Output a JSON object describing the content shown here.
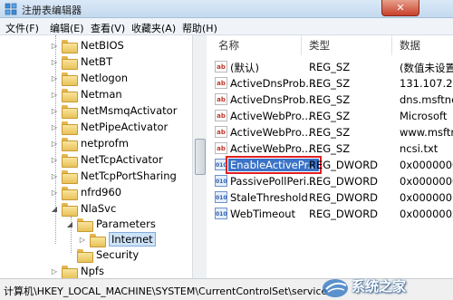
{
  "window": {
    "title": "注册表编辑器",
    "close_label": "✕"
  },
  "menu": [
    "文件(F)",
    "编辑(E)",
    "查看(V)",
    "收藏夹(A)",
    "帮助(H)"
  ],
  "tree": {
    "items": [
      {
        "label": "NetBIOS",
        "expander": "▷"
      },
      {
        "label": "NetBT",
        "expander": "▷"
      },
      {
        "label": "Netlogon",
        "expander": "▷"
      },
      {
        "label": "Netman",
        "expander": "▷"
      },
      {
        "label": "NetMsmqActivator",
        "expander": "▷"
      },
      {
        "label": "NetPipeActivator",
        "expander": "▷"
      },
      {
        "label": "netprofm",
        "expander": "▷"
      },
      {
        "label": "NetTcpActivator",
        "expander": "▷"
      },
      {
        "label": "NetTcpPortSharing",
        "expander": "▷"
      },
      {
        "label": "nfrd960",
        "expander": "▷"
      },
      {
        "label": "NlaSvc",
        "expander": "◢"
      },
      {
        "label": "Parameters",
        "expander": "◢"
      },
      {
        "label": "Internet",
        "expander": "▷"
      },
      {
        "label": "Security",
        "expander": ""
      },
      {
        "label": "Npfs",
        "expander": "▷"
      }
    ]
  },
  "columns": {
    "name": "名称",
    "type": "类型",
    "data": "数据"
  },
  "values": [
    {
      "name": "(默认)",
      "type": "REG_SZ",
      "data": "(数值未设置",
      "icon": "ab"
    },
    {
      "name": "ActiveDnsProb...",
      "type": "REG_SZ",
      "data": "131.107.25",
      "icon": "ab"
    },
    {
      "name": "ActiveDnsProb...",
      "type": "REG_SZ",
      "data": "dns.msftnc",
      "icon": "ab"
    },
    {
      "name": "ActiveWebPro...",
      "type": "REG_SZ",
      "data": "Microsoft",
      "icon": "ab"
    },
    {
      "name": "ActiveWebPro...",
      "type": "REG_SZ",
      "data": "www.msftn",
      "icon": "ab"
    },
    {
      "name": "ActiveWebPro...",
      "type": "REG_SZ",
      "data": "ncsi.txt",
      "icon": "ab"
    },
    {
      "name": "EnableActivePr...",
      "type": "REG_DWORD",
      "data": "0x0000000",
      "icon": "010",
      "selected": true
    },
    {
      "name": "PassivePollPeri...",
      "type": "REG_DWORD",
      "data": "0x0000000",
      "icon": "010"
    },
    {
      "name": "StaleThreshold",
      "type": "REG_DWORD",
      "data": "0x0000001",
      "icon": "010"
    },
    {
      "name": "WebTimeout",
      "type": "REG_DWORD",
      "data": "0x0000002",
      "icon": "010"
    }
  ],
  "statusbar": {
    "path": "计算机\\HKEY_LOCAL_MACHINE\\SYSTEM\\CurrentControlSet\\service"
  },
  "watermark": {
    "text": "系统之家"
  }
}
